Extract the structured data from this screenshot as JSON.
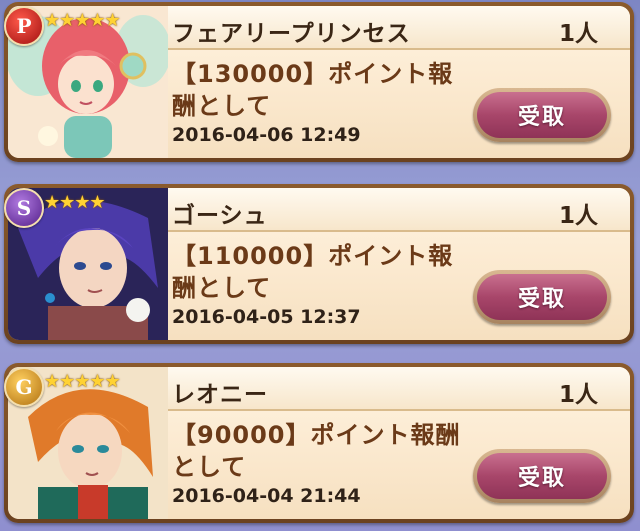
{
  "cards": [
    {
      "badge_letter": "P",
      "badge_color": "#c8201e",
      "stars": "★★★★★",
      "name": "フェアリープリンセス",
      "count": "1人",
      "reward": "【130000】ポイント報酬として",
      "date": "2016-04-06 12:49",
      "button": "受取"
    },
    {
      "badge_letter": "S",
      "badge_color": "#7a3cb0",
      "stars": "★★★★",
      "name": "ゴーシュ",
      "count": "1人",
      "reward": "【110000】ポイント報酬として",
      "date": "2016-04-05 12:37",
      "button": "受取"
    },
    {
      "badge_letter": "G",
      "badge_color": "#d7981c",
      "stars": "★★★★★",
      "name": "レオニー",
      "count": "1人",
      "reward": "【90000】ポイント報酬として",
      "date": "2016-04-04 21:44",
      "button": "受取"
    }
  ]
}
